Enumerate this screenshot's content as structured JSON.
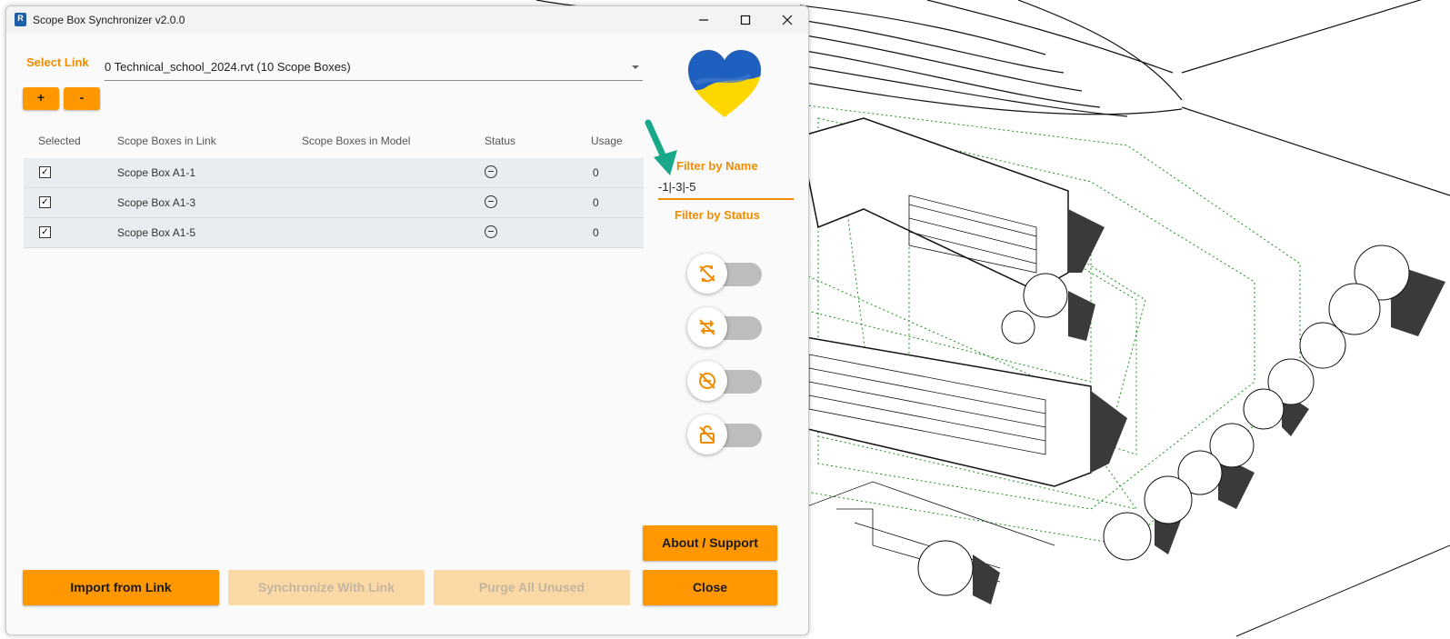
{
  "window": {
    "title": "Scope Box Synchronizer v2.0.0",
    "app_icon": "R"
  },
  "link": {
    "label": "Select Link",
    "value": "0 Technical_school_2024.rvt (10 Scope Boxes)"
  },
  "buttons": {
    "add": "+",
    "remove": "-",
    "import": "Import from Link",
    "synchronize": "Synchronize With Link",
    "purge": "Purge All Unused",
    "about": "About / Support",
    "close": "Close"
  },
  "grid": {
    "headers": {
      "selected": "Selected",
      "in_link": "Scope Boxes in Link",
      "in_model": "Scope Boxes in Model",
      "status": "Status",
      "usage": "Usage"
    },
    "rows": [
      {
        "checked": "✓",
        "name": "Scope Box A1-1",
        "model": "",
        "usage": "0"
      },
      {
        "checked": "✓",
        "name": "Scope Box A1-3",
        "model": "",
        "usage": "0"
      },
      {
        "checked": "✓",
        "name": "Scope Box A1-5",
        "model": "",
        "usage": "0"
      }
    ]
  },
  "filter": {
    "name_label": "Filter by Name",
    "name_value": "-1|-3|-5",
    "status_label": "Filter by Status"
  },
  "toggles": [
    {
      "icon": "sync-off-icon",
      "on": false
    },
    {
      "icon": "sync-icon",
      "on": false
    },
    {
      "icon": "unused-off-icon",
      "on": false
    },
    {
      "icon": "lock-off-icon",
      "on": false
    }
  ],
  "colors": {
    "accent": "#ff9800",
    "accent_text": "#f08c00",
    "disabled": "#fbd9a6",
    "row_bg": "#e9edf1",
    "arrow": "#1aa88a",
    "viewport_lines": "#1a8f1a"
  }
}
